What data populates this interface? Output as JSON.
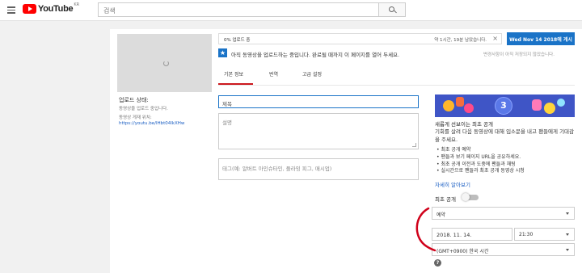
{
  "header": {
    "logo_text": "YouTube",
    "logo_region": "KR",
    "search_placeholder": "검색",
    "search_icon": "search-icon",
    "menu_icon": "hamburger-icon"
  },
  "upload": {
    "progress_text": "0% 업로드 중",
    "progress_percent": 0,
    "time_remaining": "약 1시간, 19분 남았습니다.",
    "close_symbol": "×",
    "publish_button": "Wed Nov 14 2018에 게시",
    "notice": "아직 동영상을 업로드하는 중입니다. 완료될 때까지 이 페이지를 열어 두세요.",
    "notice_right": "변경사항이 아직 저장되지 않았습니다.",
    "star_symbol": "★"
  },
  "tabs": [
    {
      "label": "기본 정보"
    },
    {
      "label": "번역"
    },
    {
      "label": "고급 설정"
    }
  ],
  "status": {
    "title": "업로드 상태:",
    "message": "동영상을 업로드 중입니다.",
    "location_label": "동영상 게재 위치:",
    "url": "https://youtu.be/lHbt04lkXHw"
  },
  "form": {
    "title_value": "제목",
    "description_placeholder": "설명",
    "tags_placeholder": "태그(예: 알버트 아인슈타인, 플라잉 피그, 매시업)"
  },
  "premiere": {
    "countdown": "3",
    "title": "새롭게 선보이는 최초 공개",
    "description": "기회를 살려 다음 동영상에 대해 입소문을 내고 팬들에게 기대감을 주세요.",
    "bullets": [
      "• 최초 공개 예약",
      "• 팬들과 보기 페이지 URL을 공유하세요.",
      "• 최초 공개 이전과 도중에 팬들과 채팅",
      "• 실시간으로 팬들과 최초 공개 동영상 시청"
    ],
    "learn_more": "자세히 알아보기",
    "toggle_label": "최초 공개",
    "toggle_on": false
  },
  "schedule": {
    "visibility": "예약",
    "date": "2018. 11. 14.",
    "time": "21:30",
    "timezone": "(GMT+0900) 한국 시간",
    "help_symbol": "?"
  },
  "colors": {
    "accent": "#1a73c7",
    "tab_underline": "#cc181e",
    "annotation": "#d0021b"
  }
}
